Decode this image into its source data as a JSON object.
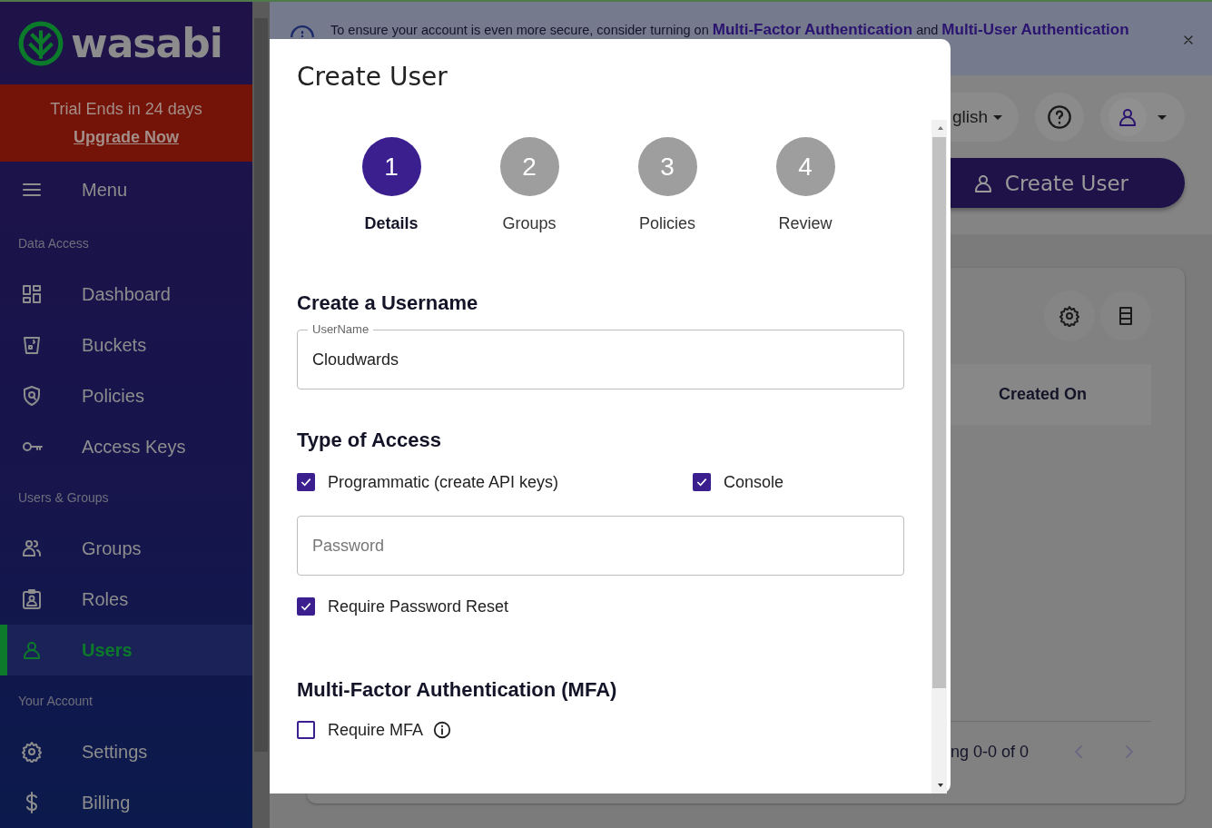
{
  "sidebar": {
    "logo": "wasabi",
    "trial": {
      "text": "Trial Ends in 24 days",
      "link": "Upgrade Now"
    },
    "menu": "Menu",
    "sections": [
      {
        "title": "Data Access",
        "items": [
          {
            "label": "Dashboard",
            "selected": false
          },
          {
            "label": "Buckets",
            "selected": false
          },
          {
            "label": "Policies",
            "selected": false
          },
          {
            "label": "Access Keys",
            "selected": false
          }
        ]
      },
      {
        "title": "Users & Groups",
        "items": [
          {
            "label": "Groups",
            "selected": false
          },
          {
            "label": "Roles",
            "selected": false
          },
          {
            "label": "Users",
            "selected": true
          }
        ]
      },
      {
        "title": "Your Account",
        "items": [
          {
            "label": "Settings",
            "selected": false
          },
          {
            "label": "Billing",
            "selected": false
          }
        ]
      }
    ]
  },
  "banner": {
    "message": [
      {
        "kind": "text",
        "text": "To ensure your account is even more secure, consider turning on"
      },
      {
        "kind": "link",
        "text": "Multi-Factor Authentication"
      },
      {
        "kind": "text",
        "text": "and"
      },
      {
        "kind": "link",
        "text": "Multi-User Authentication"
      }
    ]
  },
  "topbar": {
    "language": "glish"
  },
  "create_button": "Create User",
  "table": {
    "columns": [
      "Created On"
    ],
    "pagination": "ng 0-0 of 0"
  },
  "modal": {
    "title": "Create User",
    "steps": [
      {
        "number": "1",
        "label": "Details",
        "selected": true
      },
      {
        "number": "2",
        "label": "Groups",
        "selected": false
      },
      {
        "number": "3",
        "label": "Policies",
        "selected": false
      },
      {
        "number": "4",
        "label": "Review",
        "selected": false
      }
    ],
    "username": {
      "heading": "Create a Username",
      "label": "UserName",
      "value": "Cloudwards"
    },
    "access": {
      "heading": "Type of Access",
      "options": [
        {
          "label": "Programmatic (create API keys)",
          "checked": true
        },
        {
          "label": "Console",
          "checked": true
        }
      ],
      "password": {
        "placeholder": "Password"
      },
      "reset": {
        "label": "Require Password Reset",
        "checked": true
      }
    },
    "mfa": {
      "heading": "Multi-Factor Authentication (MFA)",
      "option": {
        "label": "Require MFA",
        "checked": false
      }
    }
  }
}
